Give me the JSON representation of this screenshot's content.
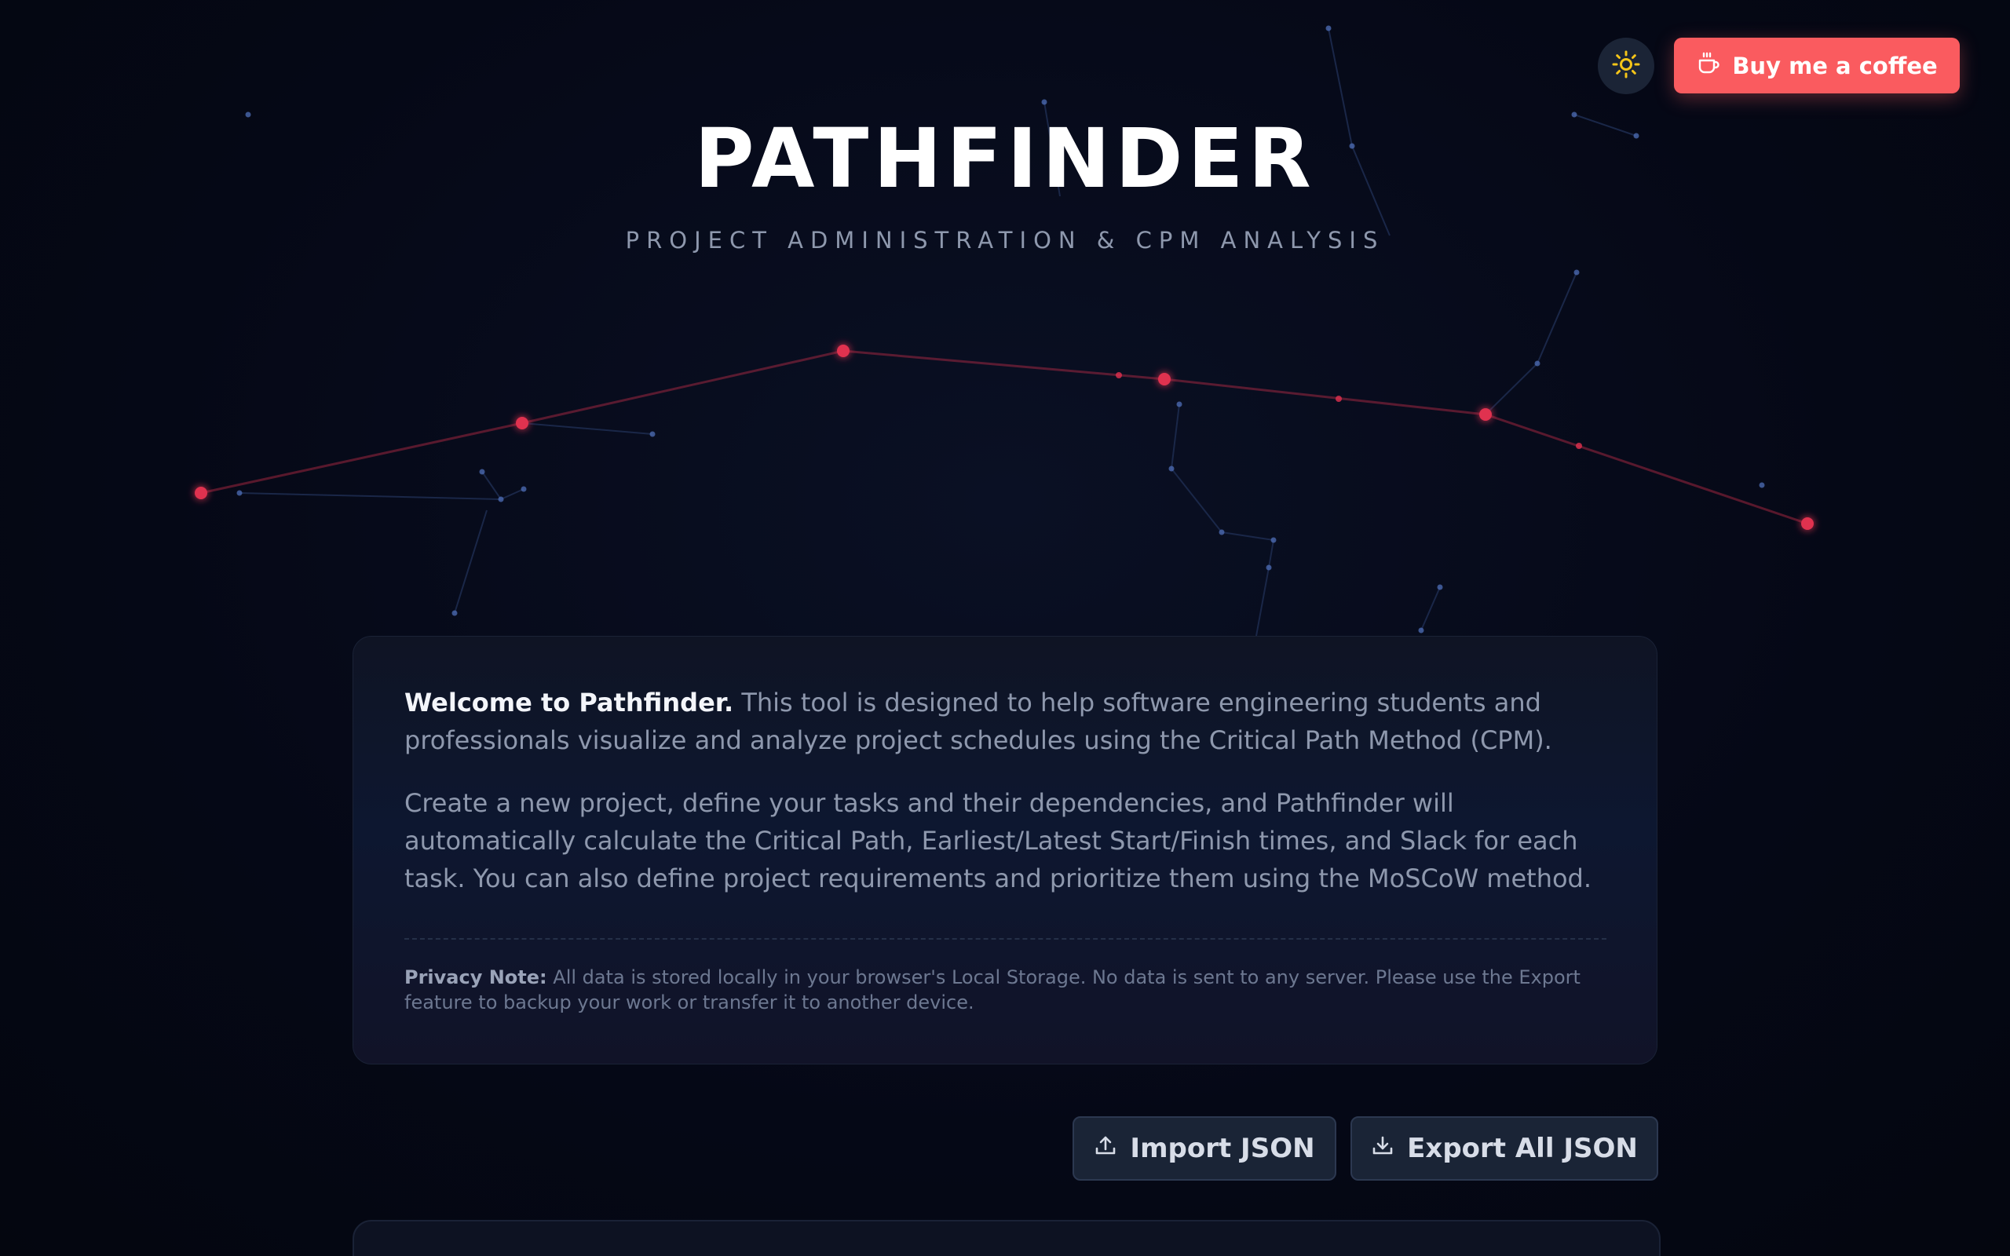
{
  "header": {
    "title": "PATHFINDER",
    "subtitle": "PROJECT ADMINISTRATION & CPM ANALYSIS"
  },
  "top_actions": {
    "theme_toggle_icon": "sun-icon",
    "coffee_label": "Buy me a coffee",
    "coffee_icon": "coffee-cup-icon"
  },
  "welcome": {
    "intro_bold": "Welcome to Pathfinder.",
    "intro_text": " This tool is designed to help software engineering students and professionals visualize and analyze project schedules using the Critical Path Method (CPM).",
    "body": "Create a new project, define your tasks and their dependencies, and Pathfinder will automatically calculate the Critical Path, Earliest/Latest Start/Finish times, and Slack for each task. You can also define project requirements and prioritize them using the MoSCoW method.",
    "privacy_label": "Privacy Note:",
    "privacy_text": " All data is stored locally in your browser's Local Storage. No data is sent to any server. Please use the Export feature to backup your work or transfer it to another device."
  },
  "data_actions": {
    "import_label": "Import JSON",
    "import_icon": "upload-icon",
    "export_label": "Export All JSON",
    "export_icon": "download-icon"
  },
  "colors": {
    "background": "#050816",
    "accent_red": "#e0314f",
    "node_blue": "#4f6fb8",
    "coffee_button": "#fa5b5f",
    "sun": "#f5c518"
  }
}
